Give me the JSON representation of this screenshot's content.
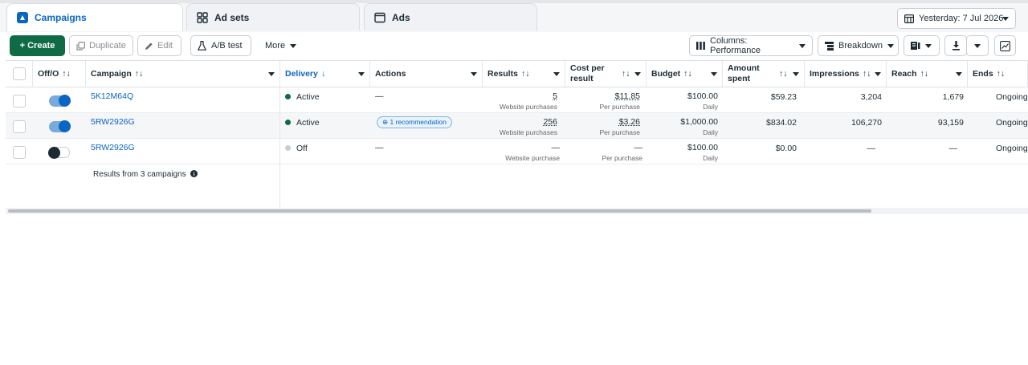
{
  "tabs": [
    {
      "label": "Campaigns",
      "icon": "campaign-icon",
      "active": true
    },
    {
      "label": "Ad sets",
      "icon": "grid-icon",
      "active": false
    },
    {
      "label": "Ads",
      "icon": "ad-window-icon",
      "active": false
    }
  ],
  "date_range": {
    "label": "Yesterday: 7 Jul 2026",
    "icon": "calendar-icon"
  },
  "toolbar": {
    "create": "+ Create",
    "duplicate": "Duplicate",
    "edit": "Edit",
    "ab_test": "A/B test",
    "more": "More",
    "columns": "Columns: Performance",
    "breakdown": "Breakdown"
  },
  "columns": {
    "off_on": "Off/O",
    "campaign": "Campaign",
    "delivery": "Delivery",
    "actions": "Actions",
    "results": "Results",
    "cost_per_result": "Cost per result",
    "budget": "Budget",
    "amount_spent": "Amount spent",
    "impressions": "Impressions",
    "reach": "Reach",
    "ends": "Ends"
  },
  "sort_glyph": "↑↓",
  "delivery_sort_glyph": "↓",
  "rows": [
    {
      "on": true,
      "campaign": "5K12M64Q",
      "delivery": "Active",
      "delivery_color": "#0f6b46",
      "actions": "—",
      "results": "5",
      "results_sub": "Website purchases",
      "cost": "$11.85",
      "cost_sub": "Per purchase",
      "budget": "$100.00",
      "budget_sub": "Daily",
      "spent": "$59.23",
      "impressions": "3,204",
      "reach": "1,679",
      "ends": "Ongoing"
    },
    {
      "on": true,
      "campaign": "5RW2926G",
      "delivery": "Active",
      "delivery_color": "#0f6b46",
      "actions": "1 recommendation",
      "results": "256",
      "results_sub": "Website purchases",
      "cost": "$3.26",
      "cost_sub": "Per purchase",
      "budget": "$1,000.00",
      "budget_sub": "Daily",
      "spent": "$834.02",
      "impressions": "106,270",
      "reach": "93,159",
      "ends": "Ongoing"
    },
    {
      "on": false,
      "campaign": "5RW2926G",
      "delivery": "Off",
      "delivery_color": "#c9ccd1",
      "actions": "—",
      "results": "—",
      "results_sub": "Website purchase",
      "cost": "—",
      "cost_sub": "Per purchase",
      "budget": "$100.00",
      "budget_sub": "Daily",
      "spent": "$0.00",
      "impressions": "—",
      "reach": "—",
      "ends": "Ongoing"
    }
  ],
  "footer": "Results from 3 campaigns",
  "colors": {
    "accent": "#0a66c2",
    "create_green": "#0f6b46",
    "toggle_on": "#0a66c2"
  }
}
